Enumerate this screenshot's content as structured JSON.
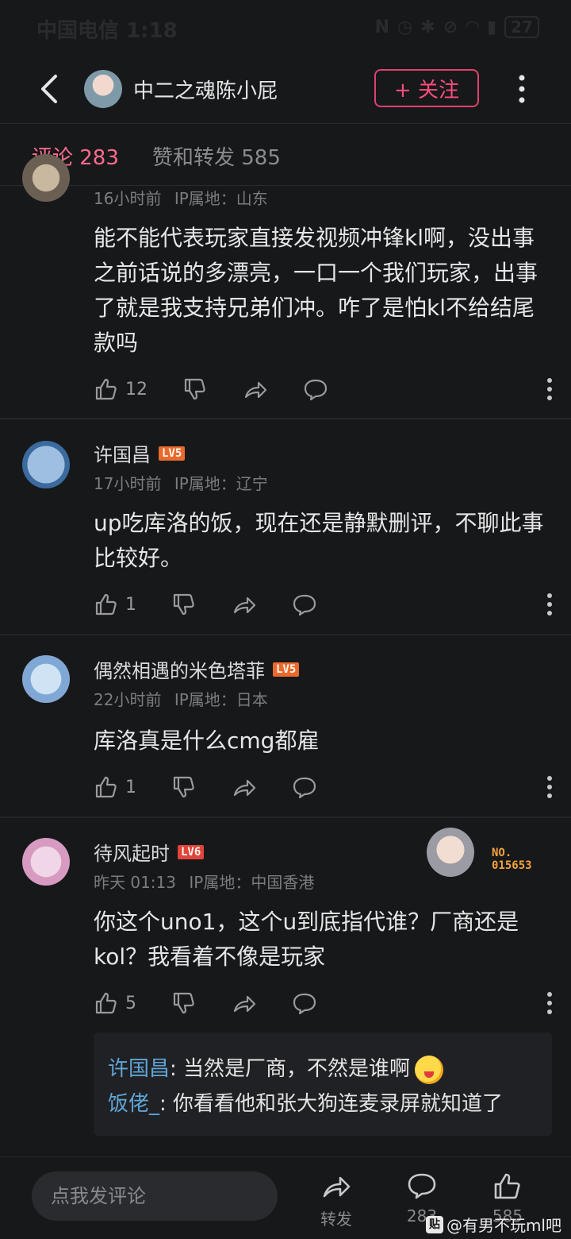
{
  "status_bar": {
    "carrier": "中国电信 1:18",
    "battery": "27"
  },
  "header": {
    "author_name": "中二之魂陈小屁",
    "follow_label": "+ 关注"
  },
  "tabs": [
    {
      "label": "评论 283",
      "active": true
    },
    {
      "label": "赞和转发 585",
      "active": false
    }
  ],
  "comments": [
    {
      "name": "",
      "time": "16小时前",
      "location": "IP属地：山东",
      "text": "能不能代表玩家直接发视频冲锋kl啊，没出事之前话说的多漂亮，一口一个我们玩家，出事了就是我支持兄弟们冲。咋了是怕kl不给结尾款吗",
      "likes": "12"
    },
    {
      "name": "许国昌",
      "level": "LV5",
      "time": "17小时前",
      "location": "IP属地：辽宁",
      "text": "up吃库洛的饭，现在还是静默删评，不聊此事比较好。",
      "likes": "1"
    },
    {
      "name": "偶然相遇的米色塔菲",
      "level": "LV5",
      "time": "22小时前",
      "location": "IP属地：日本",
      "text": "库洛真是什么cmg都雇",
      "likes": "1"
    },
    {
      "name": "待风起时",
      "level": "LV6",
      "time": "昨天 01:13",
      "location": "IP属地：中国香港",
      "text": "你这个uno1，这个u到底指代谁？厂商还是kol？我看着不像是玩家",
      "likes": "5",
      "badge_no": "NO.",
      "badge_num": "015653"
    }
  ],
  "replies": [
    {
      "name": "许国昌",
      "text": "当然是厂商，不然是谁啊"
    },
    {
      "name": "饭佬_",
      "text": "你看看他和张大狗连麦录屏就知道了"
    }
  ],
  "bottom_bar": {
    "input_placeholder": "点我发评论",
    "share_label": "转发",
    "comment_count": "283",
    "like_count": "585"
  },
  "watermark": "@有男不玩ml吧",
  "colors": {
    "accent": "#ff4d7f",
    "reply_name": "#5fa6d8",
    "background": "#17181a"
  }
}
